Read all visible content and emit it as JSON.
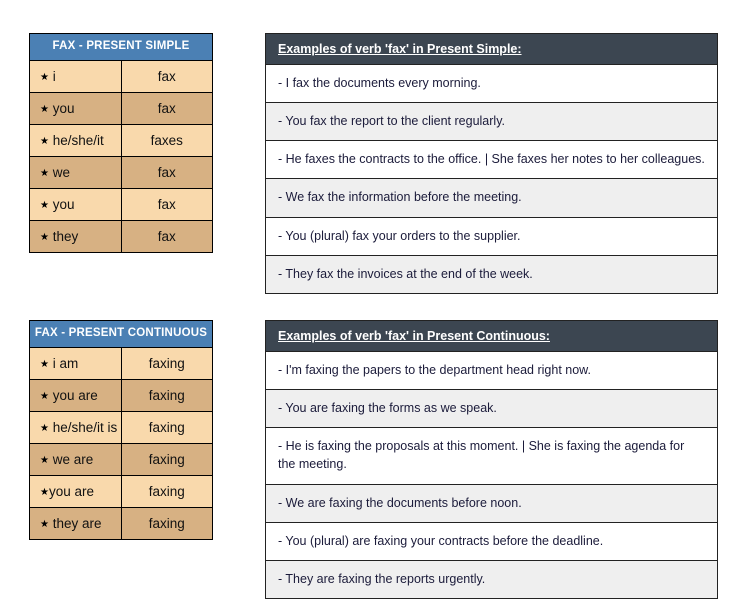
{
  "sections": [
    {
      "id": "present-simple",
      "table": {
        "header": "FAX - PRESENT SIMPLE",
        "rows": [
          {
            "pronoun": "i",
            "form": "fax",
            "star": "★",
            "gap": " "
          },
          {
            "pronoun": "you",
            "form": "fax",
            "star": "★",
            "gap": " "
          },
          {
            "pronoun": "he/she/it",
            "form": "faxes",
            "star": "★",
            "gap": " "
          },
          {
            "pronoun": "we",
            "form": "fax",
            "star": "★",
            "gap": " "
          },
          {
            "pronoun": "you",
            "form": "fax",
            "star": "★",
            "gap": " "
          },
          {
            "pronoun": "they",
            "form": "fax",
            "star": "★",
            "gap": " "
          }
        ]
      },
      "examples": {
        "header": "Examples of verb 'fax' in Present Simple:",
        "items": [
          "- I fax the documents every morning.",
          "- You fax the report to the client regularly.",
          "- He faxes the contracts to the office. | She faxes her notes to her colleagues.",
          "- We fax the information before the meeting.",
          "- You (plural) fax your orders to the supplier.",
          "- They fax the invoices at the end of the week."
        ]
      }
    },
    {
      "id": "present-continuous",
      "table": {
        "header": "FAX - PRESENT CONTINUOUS",
        "rows": [
          {
            "pronoun": "i am",
            "form": "faxing",
            "star": "★",
            "gap": " "
          },
          {
            "pronoun": "you are",
            "form": "faxing",
            "star": "★",
            "gap": " "
          },
          {
            "pronoun": "he/she/it is",
            "form": "faxing",
            "star": "★",
            "gap": " "
          },
          {
            "pronoun": "we are",
            "form": "faxing",
            "star": "★",
            "gap": " "
          },
          {
            "pronoun": "you are",
            "form": "faxing",
            "star": "★",
            "gap": ""
          },
          {
            "pronoun": "they are",
            "form": "faxing",
            "star": "★",
            "gap": " "
          }
        ]
      },
      "examples": {
        "header": "Examples of verb 'fax' in Present Continuous:",
        "items": [
          "- I'm faxing the papers to the department head right now.",
          "- You are faxing the forms as we speak.",
          "- He is faxing the proposals at this moment. | She is faxing the agenda for the meeting.",
          "- We are faxing the documents before noon.",
          "- You (plural) are faxing your contracts before the deadline.",
          "- They are faxing the reports urgently."
        ]
      }
    }
  ],
  "colors": {
    "table_header_blue": "#4B80B4",
    "row_light": "#F9D9AC",
    "row_dark": "#D7B183",
    "examples_header_dark": "#3C4651",
    "examples_row_gray": "#EFEFEF",
    "examples_text": "#1B1B3A"
  }
}
